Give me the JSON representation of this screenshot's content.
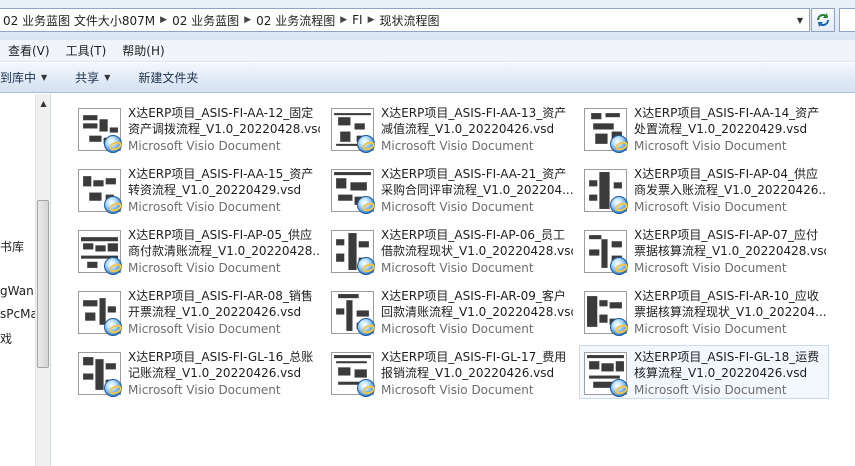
{
  "address": {
    "crumbs": [
      "02 业务蓝图 文件大小807M",
      "02 业务蓝图",
      "02 业务流程图",
      "FI",
      "现状流程图"
    ]
  },
  "menu": [
    "查看(V)",
    "工具(T)",
    "帮助(H)"
  ],
  "commands": [
    {
      "label": "到库中",
      "dropdown": true
    },
    {
      "label": "共享",
      "dropdown": true
    },
    {
      "label": "新建文件夹",
      "dropdown": false
    }
  ],
  "nav": {
    "items": [
      "书库",
      "gWan",
      "sPcMa",
      "戏"
    ]
  },
  "files": [
    {
      "name1": "X达ERP项目_ASIS-FI-AA-12_固定",
      "name2": "资产调拨流程_V1.0_20220428.vsd",
      "type": "Microsoft Visio Document",
      "icon": "visio-file-icon"
    },
    {
      "name1": "X达ERP项目_ASIS-FI-AA-13_资产",
      "name2": "减值流程_V1.0_20220426.vsd",
      "type": "Microsoft Visio Document",
      "icon": "visio-file-icon"
    },
    {
      "name1": "X达ERP项目_ASIS-FI-AA-14_资产",
      "name2": "处置流程_V1.0_20220429.vsd",
      "type": "Microsoft Visio Document",
      "icon": "visio-file-icon"
    },
    {
      "name1": "X达ERP项目_ASIS-FI-AA-15_资产",
      "name2": "转资流程_V1.0_20220429.vsd",
      "type": "Microsoft Visio Document",
      "icon": "visio-file-icon"
    },
    {
      "name1": "X达ERP项目_ASIS-FI-AA-21_资产",
      "name2": "采购合同评审流程_V1.0_202204...",
      "type": "Microsoft Visio Document",
      "icon": "visio-file-icon"
    },
    {
      "name1": "X达ERP项目_ASIS-FI-AP-04_供应",
      "name2": "商发票入账流程_V1.0_20220426....",
      "type": "Microsoft Visio Document",
      "icon": "visio-file-icon"
    },
    {
      "name1": "X达ERP项目_ASIS-FI-AP-05_供应",
      "name2": "商付款清账流程_V1.0_20220428....",
      "type": "Microsoft Visio Document",
      "icon": "visio-file-icon"
    },
    {
      "name1": "X达ERP项目_ASIS-FI-AP-06_员工",
      "name2": "借款流程现状_V1.0_20220428.vsd",
      "type": "Microsoft Visio Document",
      "icon": "visio-file-icon"
    },
    {
      "name1": "X达ERP项目_ASIS-FI-AP-07_应付",
      "name2": "票据核算流程_V1.0_20220428.vsd",
      "type": "Microsoft Visio Document",
      "icon": "visio-file-icon"
    },
    {
      "name1": "X达ERP项目_ASIS-FI-AR-08_销售",
      "name2": "开票流程_V1.0_20220426.vsd",
      "type": "Microsoft Visio Document",
      "icon": "visio-file-icon"
    },
    {
      "name1": "X达ERP项目_ASIS-FI-AR-09_客户",
      "name2": "回款清账流程_V1.0_20220428.vsd",
      "type": "Microsoft Visio Document",
      "icon": "visio-file-icon"
    },
    {
      "name1": "X达ERP项目_ASIS-FI-AR-10_应收",
      "name2": "票据核算流程现状_V1.0_202204...",
      "type": "Microsoft Visio Document",
      "icon": "visio-file-icon"
    },
    {
      "name1": "X达ERP项目_ASIS-FI-GL-16_总账",
      "name2": "记账流程_V1.0_20220426.vsd",
      "type": "Microsoft Visio Document",
      "icon": "visio-file-icon"
    },
    {
      "name1": "X达ERP项目_ASIS-FI-GL-17_费用",
      "name2": "报销流程_V1.0_20220426.vsd",
      "type": "Microsoft Visio Document",
      "icon": "visio-file-icon"
    },
    {
      "name1": "X达ERP项目_ASIS-FI-GL-18_运费",
      "name2": "核算流程_V1.0_20220426.vsd",
      "type": "Microsoft Visio Document",
      "icon": "visio-file-icon",
      "selected": true
    }
  ]
}
